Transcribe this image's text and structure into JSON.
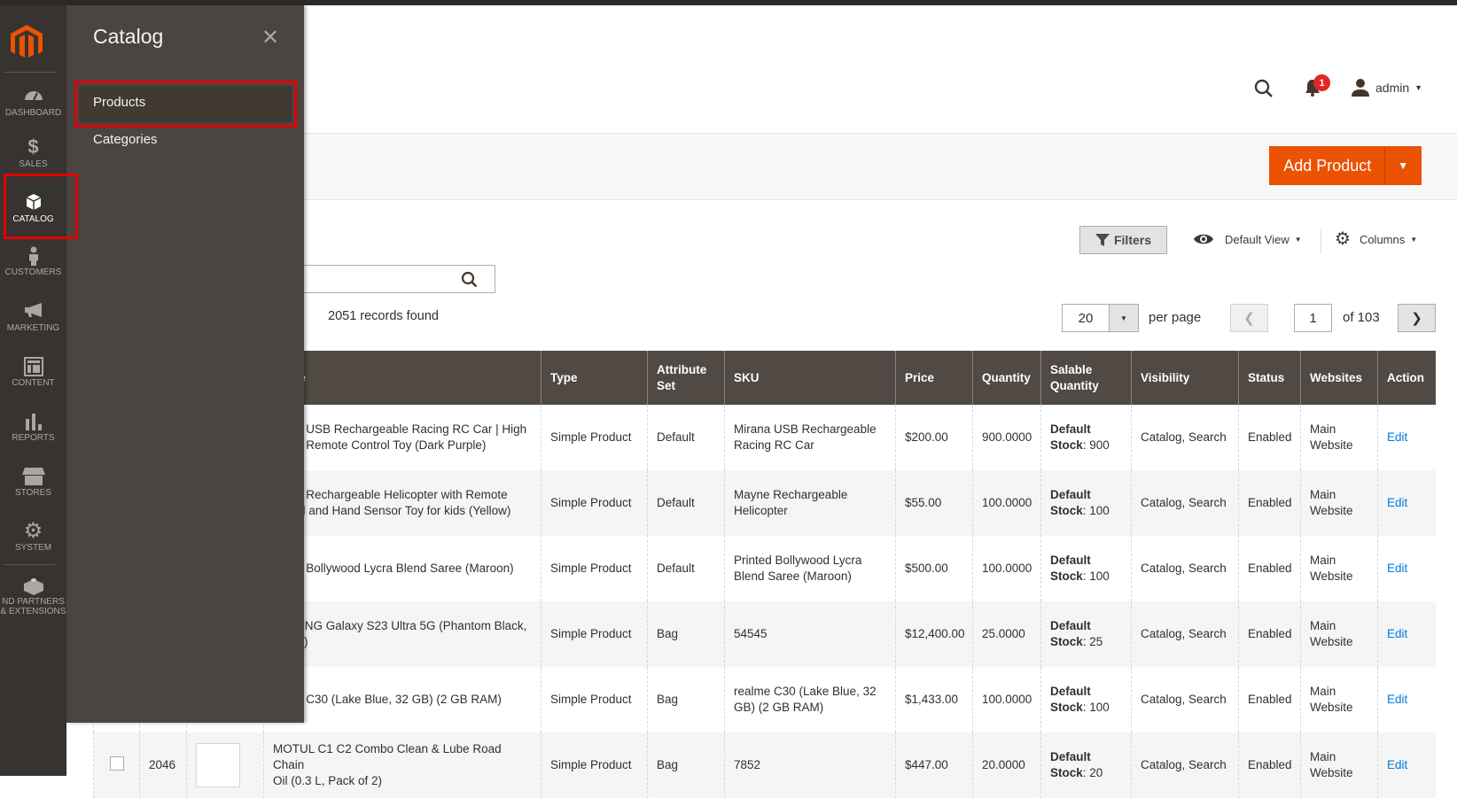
{
  "colors": {
    "accent": "#eb5202",
    "sidebar": "#373330",
    "flyout": "#4a4542",
    "table_header": "#514943",
    "link": "#007bdb",
    "highlight": "#e10000"
  },
  "sidebar": {
    "items": [
      {
        "label": "DASHBOARD",
        "icon": "dashboard-icon"
      },
      {
        "label": "SALES",
        "icon": "dollar-icon"
      },
      {
        "label": "CATALOG",
        "icon": "box-icon",
        "active": true
      },
      {
        "label": "CUSTOMERS",
        "icon": "person-icon"
      },
      {
        "label": "MARKETING",
        "icon": "megaphone-icon"
      },
      {
        "label": "CONTENT",
        "icon": "layout-icon"
      },
      {
        "label": "REPORTS",
        "icon": "bar-chart-icon"
      },
      {
        "label": "STORES",
        "icon": "store-icon"
      },
      {
        "label": "SYSTEM",
        "icon": "gear-icon"
      },
      {
        "label": "ND PARTNERS",
        "label2": "& EXTENSIONS",
        "icon": "lego-brick-icon"
      }
    ]
  },
  "flyout": {
    "title": "Catalog",
    "items": [
      "Products",
      "Categories"
    ]
  },
  "header": {
    "user": "admin",
    "notifications": "1"
  },
  "actions": {
    "add_product": "Add Product"
  },
  "toolbar": {
    "filters": "Filters",
    "view": "Default View",
    "columns": "Columns"
  },
  "grid": {
    "records": "2051 records found",
    "per_page": "20",
    "per_page_label": "per page",
    "page": "1",
    "of_pages": "of 103",
    "columns": [
      "",
      "",
      "",
      "Name",
      "Type",
      "Attribute Set",
      "SKU",
      "Price",
      "Quantity",
      "Salable Quantity",
      "Visibility",
      "Status",
      "Websites",
      "Action"
    ],
    "rows": [
      {
        "id": "",
        "name": [
          "a USB Rechargeable Racing RC Car | High",
          "d Remote Control Toy  (Dark Purple)"
        ],
        "type": "Simple Product",
        "attr": "Default",
        "sku": "Mirana USB Rechargeable Racing RC Car",
        "price": "$200.00",
        "qty": "900.0000",
        "sal_src": "Default",
        "sal_lbl": "Stock",
        "sal_qty": ": 900",
        "vis": "Catalog, Search",
        "status": "Enabled",
        "web": "Main Website",
        "action": "Edit"
      },
      {
        "id": "",
        "name": [
          "e Rechargeable Helicopter with Remote",
          "ol and Hand Sensor Toy for kids  (Yellow)"
        ],
        "type": "Simple Product",
        "attr": "Default",
        "sku": "Mayne Rechargeable Helicopter",
        "price": "$55.00",
        "qty": "100.0000",
        "sal_src": "Default",
        "sal_lbl": "Stock",
        "sal_qty": ": 100",
        "vis": "Catalog, Search",
        "status": "Enabled",
        "web": "Main Website",
        "action": "Edit"
      },
      {
        "id": "",
        "name": [
          "d Bollywood Lycra Blend Saree  (Maroon)"
        ],
        "type": "Simple Product",
        "attr": "Default",
        "sku": "Printed Bollywood Lycra Blend Saree  (Maroon)",
        "price": "$500.00",
        "qty": "100.0000",
        "sal_src": "Default",
        "sal_lbl": "Stock",
        "sal_qty": ": 100",
        "vis": "Catalog, Search",
        "status": "Enabled",
        "web": "Main Website",
        "action": "Edit"
      },
      {
        "id": "",
        "name": [
          "UNG Galaxy S23 Ultra 5G (Phantom Black,",
          "B)"
        ],
        "type": "Simple Product",
        "attr": "Bag",
        "sku": "54545",
        "price": "$12,400.00",
        "qty": "25.0000",
        "sal_src": "Default",
        "sal_lbl": "Stock",
        "sal_qty": ": 25",
        "vis": "Catalog, Search",
        "status": "Enabled",
        "web": "Main Website",
        "action": "Edit"
      },
      {
        "id": "",
        "name": [
          "e C30 (Lake Blue, 32 GB)  (2 GB RAM)"
        ],
        "type": "Simple Product",
        "attr": "Bag",
        "sku": "realme C30 (Lake Blue, 32 GB)  (2 GB RAM)",
        "price": "$1,433.00",
        "qty": "100.0000",
        "sal_src": "Default",
        "sal_lbl": "Stock",
        "sal_qty": ": 100",
        "vis": "Catalog, Search",
        "status": "Enabled",
        "web": "Main Website",
        "action": "Edit"
      },
      {
        "id": "2046",
        "name": [
          "MOTUL C1 C2 Combo Clean & Lube Road Chain",
          "Oil  (0.3 L, Pack of 2)"
        ],
        "type": "Simple Product",
        "attr": "Bag",
        "sku": "7852",
        "price": "$447.00",
        "qty": "20.0000",
        "sal_src": "Default",
        "sal_lbl": "Stock",
        "sal_qty": ": 20",
        "vis": "Catalog, Search",
        "status": "Enabled",
        "web": "Main Website",
        "action": "Edit"
      }
    ]
  }
}
